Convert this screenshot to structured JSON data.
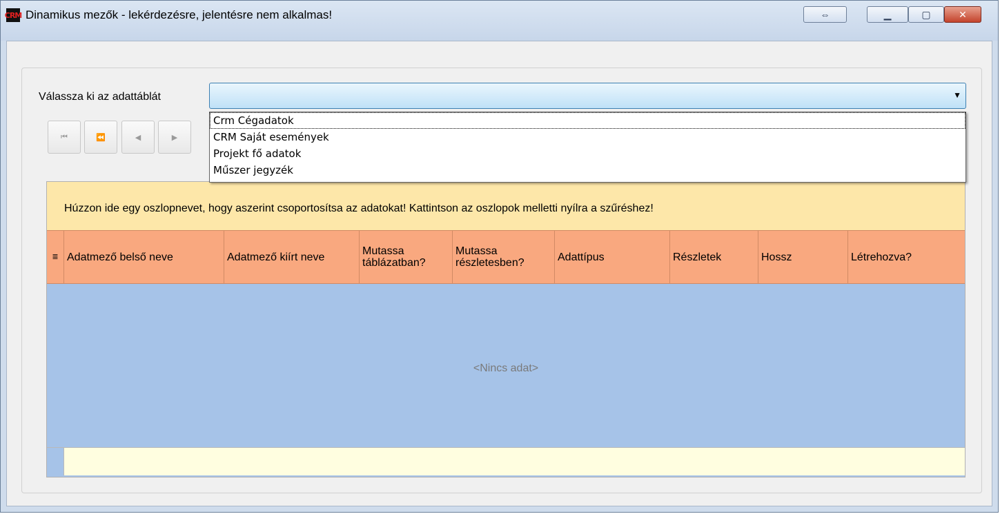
{
  "window": {
    "title": "Dinamikus mezők - lekérdezésre, jelentésre nem alkalmas!",
    "icon": "crm-app-icon",
    "icon_text": "CRM",
    "buttons": {
      "expand": "⇔",
      "minimize": "▁",
      "maximize": "▢",
      "close": "✕"
    }
  },
  "table_select": {
    "label": "Válassza ki az adattáblát",
    "value": "",
    "arrow": "▼",
    "options": [
      "Crm Cégadatok",
      "CRM Saját események",
      "Projekt fő adatok",
      "Műszer jegyzék"
    ],
    "focused_index": 0
  },
  "navigator": {
    "first": "⏮",
    "prev_page": "⏪",
    "prev": "◀",
    "next": "▶"
  },
  "grid": {
    "group_panel_text": "Húzzon ide egy oszlopnevet, hogy aszerint csoportosítsa az adatokat! Kattintson az oszlopok melletti nyílra a szűréshez!",
    "indicator_icon": "≣",
    "columns": [
      "Adatmező belső neve",
      "Adatmező kiírt neve",
      "Mutassa táblázatban?",
      "Mutassa részletesben?",
      "Adattípus",
      "Részletek",
      "Hossz",
      "Létrehozva?"
    ],
    "empty_text": "<Nincs adat>"
  },
  "colors": {
    "group_panel": "#fde7a9",
    "header": "#f9a87f",
    "grid_bg": "#a6c3e8",
    "filter_row": "#fffee0"
  }
}
